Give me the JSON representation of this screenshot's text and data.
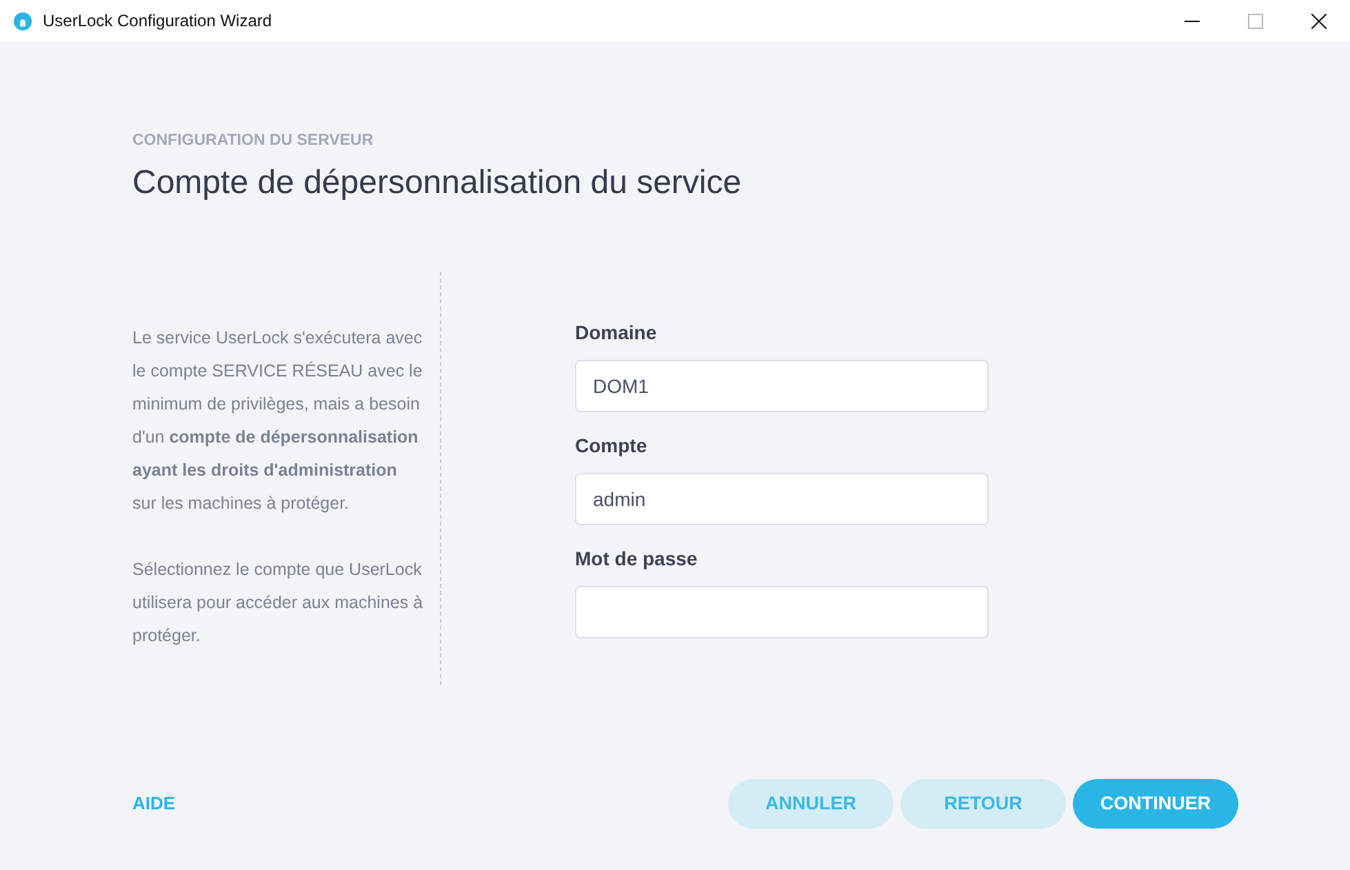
{
  "window": {
    "title": "UserLock Configuration Wizard"
  },
  "header": {
    "section": "CONFIGURATION DU SERVEUR",
    "title": "Compte de dépersonnalisation du service"
  },
  "description": [
    "Le service UserLock s'exécutera avec le compte SERVICE RÉSEAU avec le minimum de privilèges, mais a besoin d'un **compte de dépersonnalisation ayant les droits d'administration** sur les machines à protéger.",
    "Sélectionnez le compte que UserLock utilisera pour accéder aux machines à protéger."
  ],
  "fields": [
    {
      "label": "Domaine",
      "value": "DOM1"
    },
    {
      "label": "Compte",
      "value": "admin"
    },
    {
      "label": "Mot de passe"
    }
  ],
  "help_link": "AIDE",
  "buttons": [
    {
      "label": "ANNULER",
      "kind": "secondary"
    },
    {
      "label": "RETOUR",
      "kind": "secondary"
    },
    {
      "label": "CONTINUER",
      "kind": "primary"
    }
  ]
}
